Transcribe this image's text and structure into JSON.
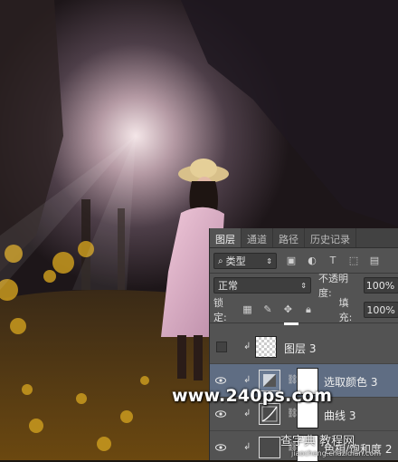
{
  "panel": {
    "tabs": [
      "图层",
      "通道",
      "路径",
      "历史记录"
    ],
    "filter_label": "类型",
    "blend_mode": "正常",
    "opacity_label": "不透明度:",
    "opacity_value": "100%",
    "lock_label": "锁定:",
    "fill_label": "填充:",
    "fill_value": "100%",
    "layers": [
      {
        "name": "图层 3",
        "visible": false,
        "selected": false
      },
      {
        "name": "选取颜色 3",
        "visible": true,
        "selected": true
      },
      {
        "name": "曲线 3",
        "visible": true,
        "selected": false
      },
      {
        "name": "色相/饱和度 2",
        "visible": true,
        "selected": false
      }
    ]
  },
  "watermark": {
    "main": "www.240ps.com",
    "site": "查字典 教程网",
    "url": "jiaocheng.chazidian.com"
  },
  "colors": {
    "panel_bg": "#535353",
    "selected_row": "#5f6d83",
    "tab_bar": "#424242"
  }
}
